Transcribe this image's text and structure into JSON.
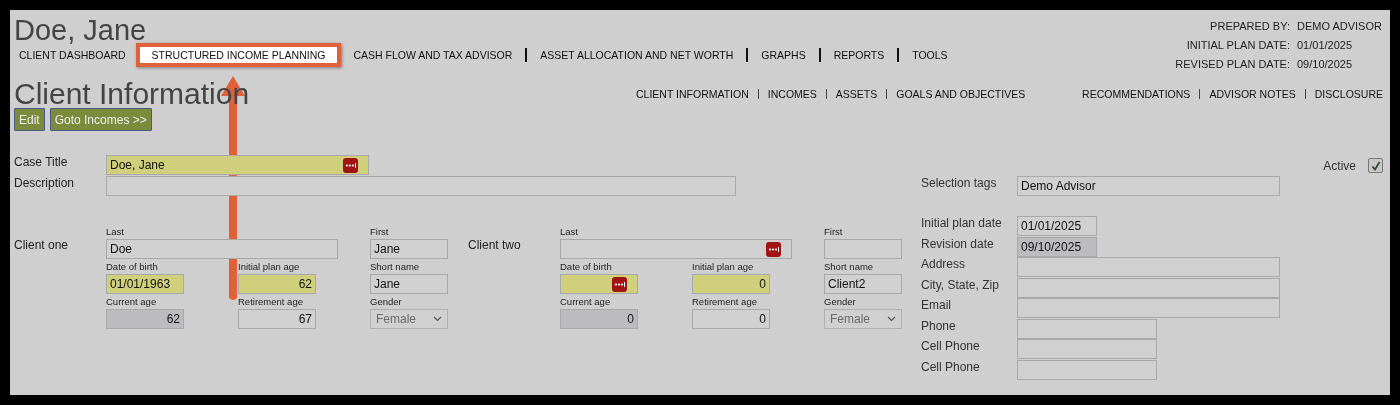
{
  "client_name": "Doe, Jane",
  "plan_info": [
    {
      "label": "PREPARED BY:",
      "value": "DEMO ADVISOR"
    },
    {
      "label": "INITIAL PLAN DATE:",
      "value": "01/01/2025"
    },
    {
      "label": "REVISED PLAN DATE:",
      "value": "09/10/2025"
    }
  ],
  "main_nav": [
    {
      "label": "CLIENT DASHBOARD",
      "highlighted": false
    },
    {
      "label": "STRUCTURED INCOME PLANNING",
      "highlighted": true
    },
    {
      "label": "CASH FLOW AND TAX ADVISOR",
      "highlighted": false
    },
    {
      "label": "ASSET ALLOCATION AND NET WORTH",
      "highlighted": false
    },
    {
      "label": "GRAPHS",
      "highlighted": false
    },
    {
      "label": "REPORTS",
      "highlighted": false
    },
    {
      "label": "TOOLS",
      "highlighted": false
    }
  ],
  "page_title": "Client Information",
  "sub_nav": {
    "left": [
      "CLIENT INFORMATION",
      "INCOMES",
      "ASSETS",
      "GOALS AND OBJECTIVES"
    ],
    "right": [
      "RECOMMENDATIONS",
      "ADVISOR NOTES",
      "DISCLOSURE"
    ]
  },
  "buttons": [
    "Edit",
    "Goto Incomes >>"
  ],
  "case_title": {
    "label": "Case Title",
    "value": "Doe, Jane",
    "highlighted": true,
    "lookup_button": true
  },
  "description": {
    "label": "Description"
  },
  "clients": [
    {
      "label": "Client one",
      "fields": [
        {
          "label": "Last",
          "value": "Doe",
          "kind": "text"
        },
        {
          "label": "First",
          "value": "Jane",
          "kind": "text"
        },
        {
          "label": "Date of birth",
          "value": "01/01/1963",
          "kind": "text",
          "highlighted": true
        },
        {
          "label": "Initial plan age",
          "value": "62",
          "kind": "number",
          "highlighted": true
        },
        {
          "label": "Short name",
          "value": "Jane",
          "kind": "text"
        },
        {
          "label": "Current age",
          "value": "62",
          "kind": "number",
          "readonly": true
        },
        {
          "label": "Retirement age",
          "value": "67",
          "kind": "number"
        },
        {
          "label": "Gender",
          "value": "Female",
          "kind": "select",
          "disabled": true
        }
      ]
    },
    {
      "label": "Client two",
      "fields": [
        {
          "label": "Last",
          "kind": "text",
          "lookup_button": true
        },
        {
          "label": "First",
          "kind": "text"
        },
        {
          "label": "Date of birth",
          "kind": "text",
          "highlighted": true,
          "lookup_button": true
        },
        {
          "label": "Initial plan age",
          "value": "0",
          "kind": "number",
          "highlighted": true
        },
        {
          "label": "Short name",
          "value": "Client2",
          "kind": "text"
        },
        {
          "label": "Current age",
          "value": "0",
          "kind": "number",
          "readonly": true
        },
        {
          "label": "Retirement age",
          "value": "0",
          "kind": "number"
        },
        {
          "label": "Gender",
          "value": "Female",
          "kind": "select",
          "disabled": true
        }
      ]
    }
  ],
  "active": {
    "label": "Active",
    "checked": true
  },
  "selection_tags": {
    "label": "Selection tags",
    "value": "Demo Advisor"
  },
  "contact_fields": [
    {
      "label": "Initial plan date",
      "value": "01/01/2025",
      "kind": "date"
    },
    {
      "label": "Revision date",
      "value": "09/10/2025",
      "kind": "date",
      "readonly": true
    },
    {
      "label": "Address",
      "kind": "wide"
    },
    {
      "label": "City, State, Zip",
      "kind": "wide"
    },
    {
      "label": "Email",
      "kind": "wide"
    },
    {
      "label": "Phone",
      "kind": "medium"
    },
    {
      "label": "Cell Phone",
      "kind": "medium"
    },
    {
      "label": "Cell Phone",
      "kind": "medium"
    }
  ]
}
